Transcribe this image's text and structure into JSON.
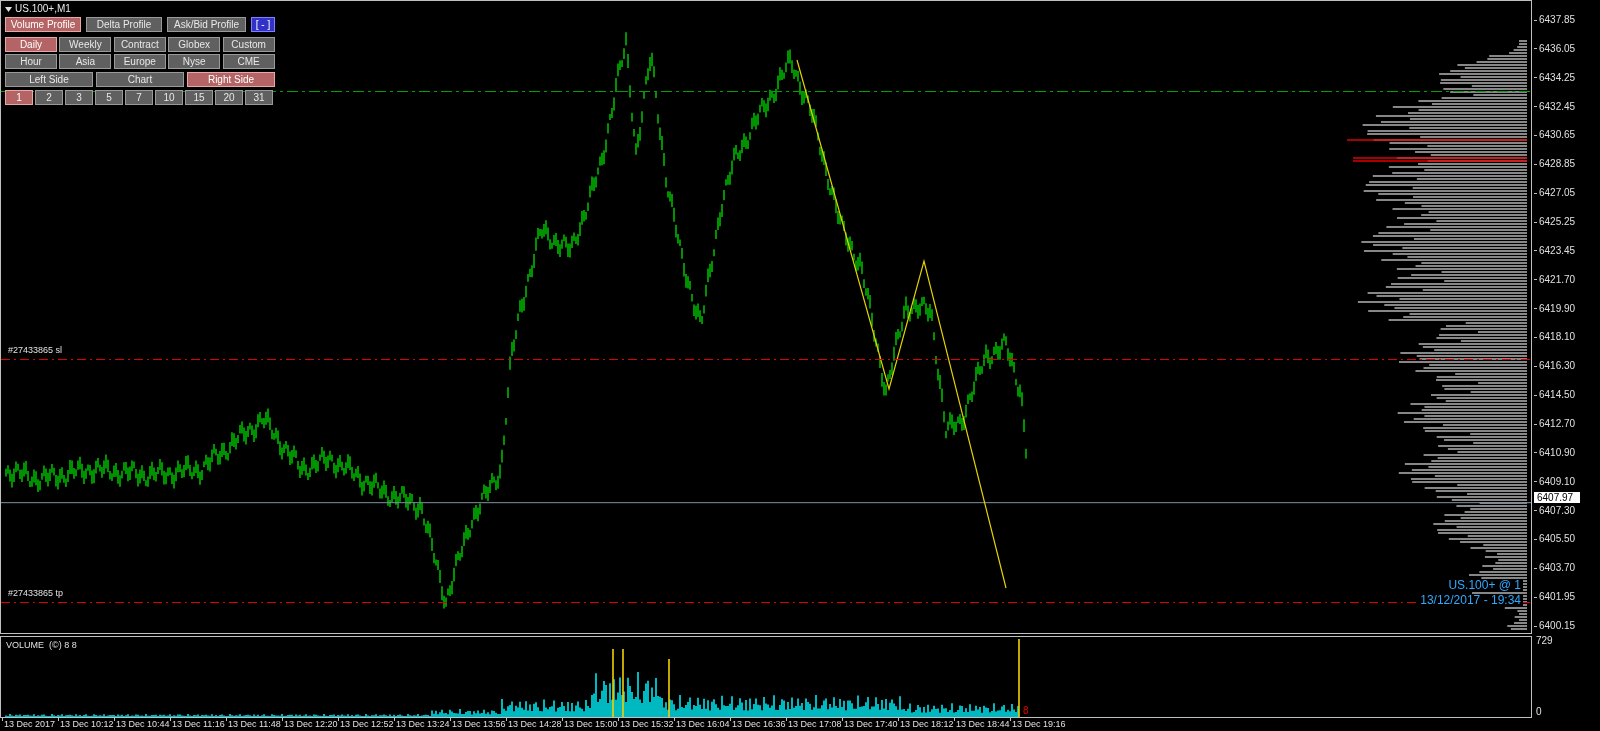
{
  "chart": {
    "symbol": "US.100+,M1",
    "profile_buttons": [
      {
        "label": "Volume Profile",
        "selected": true
      },
      {
        "label": "Delta Profile",
        "selected": false
      },
      {
        "label": "Ask/Bid Profile",
        "selected": false
      }
    ],
    "collapse_button": "[ - ]",
    "session_buttons": [
      {
        "label": "Daily",
        "selected": true
      },
      {
        "label": "Weekly",
        "selected": false
      },
      {
        "label": "Contract",
        "selected": false
      },
      {
        "label": "Globex",
        "selected": false
      },
      {
        "label": "Custom",
        "selected": false
      },
      {
        "label": "Hour",
        "selected": false
      },
      {
        "label": "Asia",
        "selected": false
      },
      {
        "label": "Europe",
        "selected": false
      },
      {
        "label": "Nyse",
        "selected": false
      },
      {
        "label": "CME",
        "selected": false
      }
    ],
    "side_buttons": [
      {
        "label": "Left Side",
        "selected": false
      },
      {
        "label": "Chart",
        "selected": false
      },
      {
        "label": "Right Side",
        "selected": true
      }
    ],
    "day_buttons": [
      {
        "label": "1",
        "selected": true
      },
      {
        "label": "2",
        "selected": false
      },
      {
        "label": "3",
        "selected": false
      },
      {
        "label": "5",
        "selected": false
      },
      {
        "label": "7",
        "selected": false
      },
      {
        "label": "10",
        "selected": false
      },
      {
        "label": "15",
        "selected": false
      },
      {
        "label": "20",
        "selected": false
      },
      {
        "label": "31",
        "selected": false
      }
    ],
    "price_lines": [
      {
        "kind": "level",
        "color": "#00a000"
      },
      {
        "kind": "order",
        "color": "#e00000",
        "label": "#27433865 sl"
      },
      {
        "kind": "order",
        "color": "#e00000",
        "label": "#27433865 tp"
      }
    ],
    "symbol_info": "US.100+ @ 1",
    "timestamp": "13/12/2017 - 19:34"
  },
  "price_axis": {
    "labels": [
      "6437.85",
      "6436.05",
      "6434.25",
      "6432.45",
      "6430.65",
      "6428.85",
      "6427.05",
      "6425.25",
      "6423.45",
      "6421.70",
      "6419.90",
      "6418.10",
      "6416.30",
      "6414.50",
      "6412.70",
      "6410.90",
      "6409.10",
      "6407.30",
      "6405.50",
      "6403.70",
      "6401.95",
      "6400.15"
    ],
    "current_price": "6407.97"
  },
  "volume_panel": {
    "title": "VOLUME  (©) 8 8",
    "last_value": "8",
    "scale": [
      "729",
      "0"
    ]
  },
  "time_axis": {
    "labels": [
      "13 Dec 2017",
      "13 Dec 10:12",
      "13 Dec 10:44",
      "13 Dec 11:16",
      "13 Dec 11:48",
      "13 Dec 12:20",
      "13 Dec 12:52",
      "13 Dec 13:24",
      "13 Dec 13:56",
      "13 Dec 14:28",
      "13 Dec 15:00",
      "13 Dec 15:32",
      "13 Dec 16:04",
      "13 Dec 16:36",
      "13 Dec 17:08",
      "13 Dec 17:40",
      "13 Dec 18:12",
      "13 Dec 18:44",
      "13 Dec 19:16"
    ]
  }
}
